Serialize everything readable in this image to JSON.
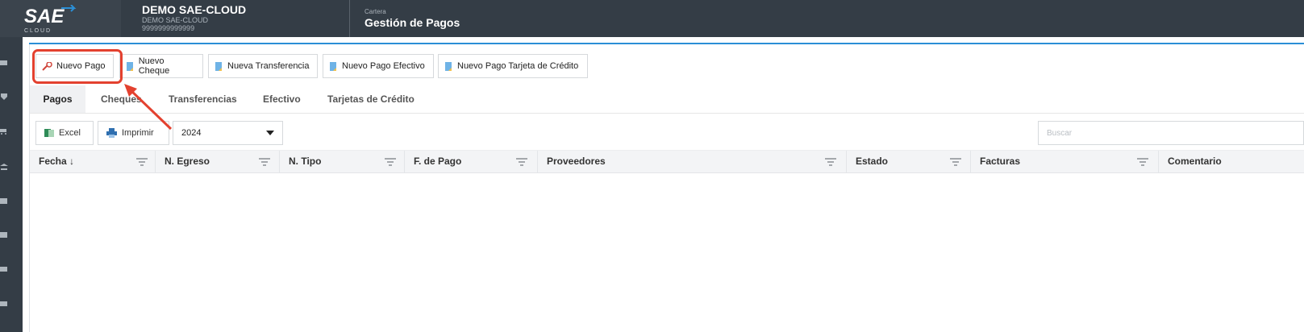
{
  "header": {
    "logo_text": "SAE",
    "logo_sub": "C L O U D",
    "company_name": "DEMO SAE-CLOUD",
    "company_sub": "DEMO SAE-CLOUD",
    "company_id": "9999999999999",
    "module_crumb": "Cartera",
    "module_title": "Gestión de Pagos"
  },
  "toolbar": {
    "buttons": [
      {
        "label": "Nuevo Pago",
        "icon": "payment-icon"
      },
      {
        "label": "Nuevo Cheque",
        "icon": "document-icon"
      },
      {
        "label": "Nueva Transferencia",
        "icon": "document-icon"
      },
      {
        "label": "Nuevo Pago Efectivo",
        "icon": "document-icon"
      },
      {
        "label": "Nuevo Pago Tarjeta de Crédito",
        "icon": "document-icon"
      }
    ]
  },
  "tabs": [
    "Pagos",
    "Cheques",
    "Transferencias",
    "Efectivo",
    "Tarjetas de Crédito"
  ],
  "active_tab": "Pagos",
  "actions": {
    "excel": "Excel",
    "print": "Imprimir"
  },
  "year_select": {
    "value": "2024"
  },
  "search": {
    "placeholder": "Buscar"
  },
  "grid": {
    "columns": [
      "Fecha ↓",
      "N. Egreso",
      "N. Tipo",
      "F. de Pago",
      "Proveedores",
      "Estado",
      "Facturas",
      "Comentario"
    ],
    "rows": []
  },
  "colors": {
    "topbar": "#343d46",
    "accent": "#2b8fd6",
    "highlight": "#e3412f"
  }
}
